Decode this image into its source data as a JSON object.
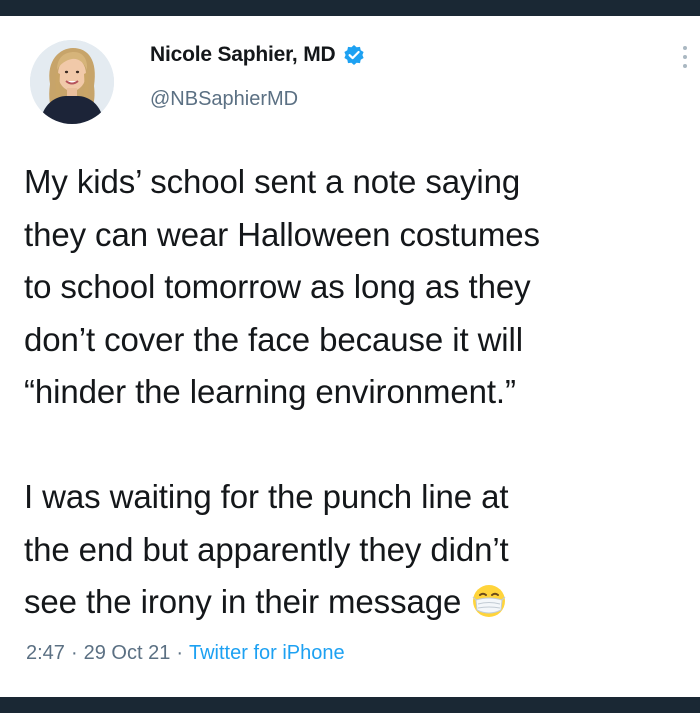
{
  "tweet": {
    "author": {
      "display_name": "Nicole Saphier, MD",
      "handle": "@NBSaphierMD",
      "verified": true,
      "verified_icon": "verified-badge-icon",
      "avatar_icon": "profile-photo"
    },
    "text": "My kids’ school sent a note saying\nthey can wear Halloween costumes\nto school tomorrow as long as they\ndon’t cover the face because it will\n“hinder the learning environment.”\n\nI was waiting for the punch line at\nthe end but apparently they didn’t\nsee the irony in their message",
    "trailing_emoji": "face-with-medical-mask",
    "time": "2:47",
    "date": "29 Oct 21",
    "separator": "·",
    "source": "Twitter for iPhone"
  },
  "colors": {
    "background": "#ffffff",
    "text": "#14171a",
    "secondary_text": "#5b7083",
    "accent": "#1da1f2",
    "frame": "#1a2834"
  }
}
